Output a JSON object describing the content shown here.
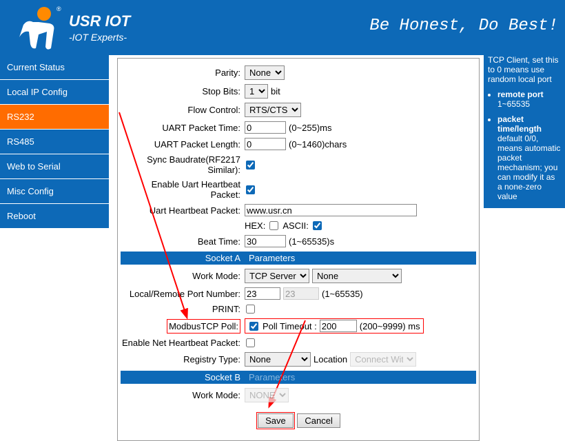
{
  "header": {
    "title": "USR IOT",
    "subtitle": "-IOT Experts-",
    "slogan": "Be Honest, Do Best!"
  },
  "sidebar": {
    "items": [
      {
        "label": "Current Status"
      },
      {
        "label": "Local IP Config"
      },
      {
        "label": "RS232"
      },
      {
        "label": "RS485"
      },
      {
        "label": "Web to Serial"
      },
      {
        "label": "Misc Config"
      },
      {
        "label": "Reboot"
      }
    ]
  },
  "form": {
    "parity": {
      "label": "Parity:",
      "value": "None"
    },
    "stopbits": {
      "label": "Stop Bits:",
      "value": "1",
      "suffix": "bit"
    },
    "flow": {
      "label": "Flow Control:",
      "value": "RTS/CTS"
    },
    "uart_time": {
      "label": "UART Packet Time:",
      "value": "0",
      "suffix": "(0~255)ms"
    },
    "uart_len": {
      "label": "UART Packet Length:",
      "value": "0",
      "suffix": "(0~1460)chars"
    },
    "sync": {
      "label": "Sync Baudrate(RF2217 Similar):"
    },
    "enable_uart_hb": {
      "label": "Enable Uart Heartbeat Packet:"
    },
    "uart_hb_pkt": {
      "label": "Uart Heartbeat Packet:",
      "value": "www.usr.cn"
    },
    "hex_ascii": {
      "hex": "HEX:",
      "ascii": "ASCII:"
    },
    "beat_time": {
      "label": "Beat Time:",
      "value": "30",
      "suffix": "(1~65535)s"
    },
    "socket_a": {
      "left": "Socket A",
      "right": "Parameters"
    },
    "work_mode_a": {
      "label": "Work Mode:",
      "value": "TCP Server",
      "value2": "None"
    },
    "port": {
      "label": "Local/Remote Port Number:",
      "v1": "23",
      "v2": "23",
      "suffix": "(1~65535)"
    },
    "print": {
      "label": "PRINT:"
    },
    "modbus": {
      "label": "ModbusTCP Poll:",
      "poll_label": "Poll Timeout :",
      "value": "200",
      "suffix": "(200~9999) ms"
    },
    "enable_net_hb": {
      "label": "Enable Net Heartbeat Packet:"
    },
    "registry": {
      "label": "Registry Type:",
      "value": "None",
      "loc_label": "Location",
      "loc_value": "Connect With"
    },
    "socket_b": {
      "left": "Socket B",
      "right": "Parameters"
    },
    "work_mode_b": {
      "label": "Work Mode:",
      "value": "NONE"
    },
    "save": "Save",
    "cancel": "Cancel"
  },
  "helper": {
    "pre1": "TCP Client, set this to 0 means use random local port",
    "items": [
      {
        "title": "remote port",
        "text": "1~65535"
      },
      {
        "title": "packet time/length",
        "text": "default 0/0, means automatic packet mechanism; you can modify it as a none-zero value"
      }
    ]
  }
}
